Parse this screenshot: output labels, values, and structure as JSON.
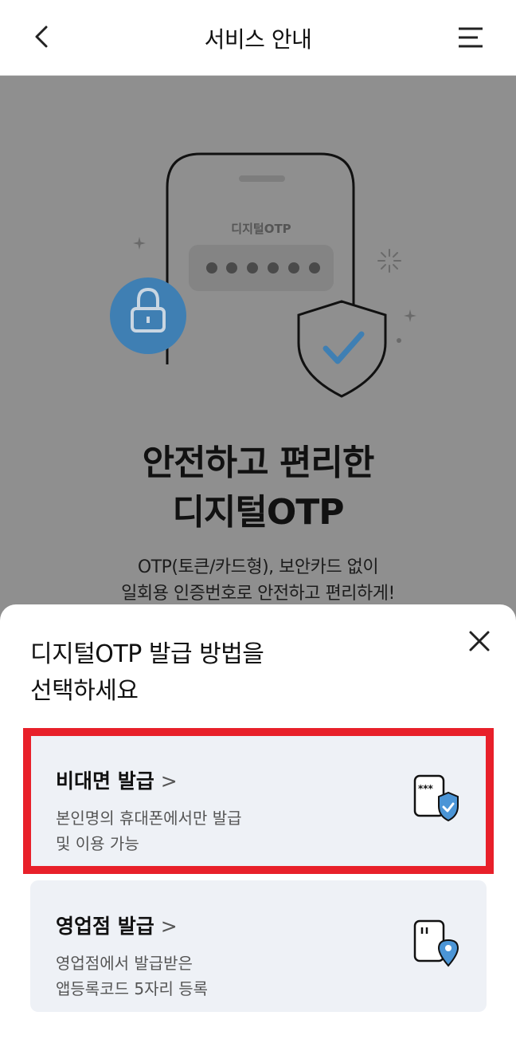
{
  "header": {
    "title": "서비스 안내",
    "back_icon": "chevron-left-icon",
    "menu_icon": "hamburger-menu-icon"
  },
  "hero": {
    "card_label": "디지털OTP",
    "pin_dots": 6,
    "title_line1": "안전하고 편리한",
    "title_line2": "디지털OTP",
    "desc_line1": "OTP(토큰/카드형), 보안카드 없이",
    "desc_line2": "일회용 인증번호로 안전하고 편리하게!"
  },
  "sheet": {
    "title_line1": "디지털OTP 발급 방법을",
    "title_line2": "선택하세요",
    "close_icon": "close-icon",
    "options": [
      {
        "label": "비대면 발급",
        "desc_line1": "본인명의 휴대폰에서만 발급",
        "desc_line2": "및 이용 가능",
        "icon": "phone-shield-icon"
      },
      {
        "label": "영업점 발급",
        "desc_line1": "영업점에서 발급받은",
        "desc_line2": "앱등록코드 5자리 등록",
        "icon": "phone-location-icon"
      }
    ]
  },
  "colors": {
    "overlay_bg": "#8f8f8f",
    "accent_blue": "#4b95d6",
    "highlight_red": "#e8202a",
    "card_bg": "#eef1f6"
  }
}
